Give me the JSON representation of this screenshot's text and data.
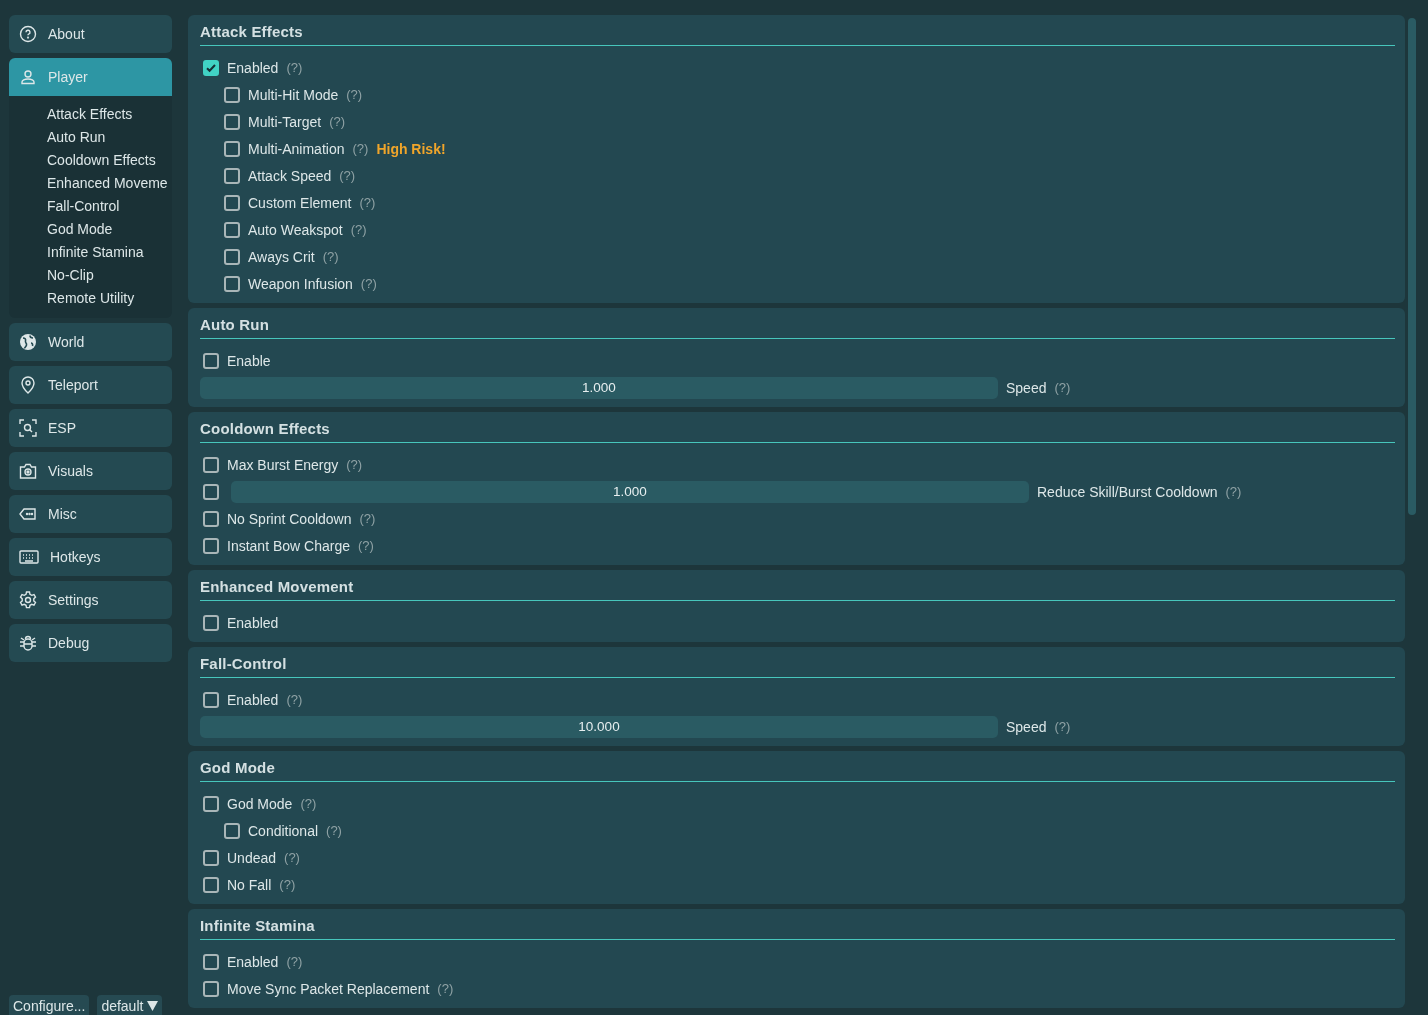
{
  "sidebar": {
    "items": [
      {
        "label": "About",
        "selected": false
      },
      {
        "label": "Player",
        "selected": true,
        "children": [
          "Attack Effects",
          "Auto Run",
          "Cooldown Effects",
          "Enhanced Moveme",
          "Fall-Control",
          "God Mode",
          "Infinite Stamina",
          "No-Clip",
          "Remote Utility"
        ]
      },
      {
        "label": "World",
        "selected": false
      },
      {
        "label": "Teleport",
        "selected": false
      },
      {
        "label": "ESP",
        "selected": false
      },
      {
        "label": "Visuals",
        "selected": false
      },
      {
        "label": "Misc",
        "selected": false
      },
      {
        "label": "Hotkeys",
        "selected": false
      },
      {
        "label": "Settings",
        "selected": false
      },
      {
        "label": "Debug",
        "selected": false
      }
    ],
    "configure_button": "Configure...",
    "profile_dropdown": "default"
  },
  "sections": [
    {
      "title": "Attack Effects",
      "rows": [
        {
          "kind": "checkbox",
          "label": "Enabled",
          "help": "(?)",
          "checked": true,
          "children": [
            {
              "kind": "checkbox",
              "label": "Multi-Hit Mode",
              "help": "(?)",
              "checked": false
            },
            {
              "kind": "checkbox",
              "label": "Multi-Target",
              "help": "(?)",
              "checked": false
            },
            {
              "kind": "checkbox",
              "label": "Multi-Animation",
              "help": "(?)",
              "warning": "High Risk!",
              "checked": false
            },
            {
              "kind": "checkbox",
              "label": "Attack Speed",
              "help": "(?)",
              "checked": false
            },
            {
              "kind": "checkbox",
              "label": "Custom Element",
              "help": "(?)",
              "checked": false
            },
            {
              "kind": "checkbox",
              "label": "Auto Weakspot",
              "help": "(?)",
              "checked": false
            },
            {
              "kind": "checkbox",
              "label": "Aways Crit",
              "help": "(?)",
              "checked": false
            },
            {
              "kind": "checkbox",
              "label": "Weapon Infusion",
              "help": "(?)",
              "checked": false
            }
          ]
        }
      ]
    },
    {
      "title": "Auto Run",
      "rows": [
        {
          "kind": "checkbox",
          "label": "Enable",
          "checked": false
        },
        {
          "kind": "slider",
          "value": "1.000",
          "level": 0,
          "label": "Speed",
          "help": "(?)"
        }
      ]
    },
    {
      "title": "Cooldown Effects",
      "rows": [
        {
          "kind": "checkbox",
          "label": "Max Burst Energy",
          "help": "(?)",
          "checked": false
        },
        {
          "kind": "checkbox_slider",
          "checked": false,
          "value": "1.000",
          "level": 0,
          "label": "Reduce Skill/Burst Cooldown",
          "help": "(?)"
        },
        {
          "kind": "checkbox",
          "label": "No Sprint Cooldown",
          "help": "(?)",
          "checked": false
        },
        {
          "kind": "checkbox",
          "label": "Instant Bow Charge",
          "help": "(?)",
          "checked": false
        }
      ]
    },
    {
      "title": "Enhanced Movement",
      "rows": [
        {
          "kind": "checkbox",
          "label": "Enabled",
          "checked": false
        }
      ]
    },
    {
      "title": "Fall-Control",
      "rows": [
        {
          "kind": "checkbox",
          "label": "Enabled",
          "help": "(?)",
          "checked": false
        },
        {
          "kind": "slider",
          "value": "10.000",
          "level": 0,
          "label": "Speed",
          "help": "(?)"
        }
      ]
    },
    {
      "title": "God Mode",
      "rows": [
        {
          "kind": "checkbox",
          "label": "God Mode",
          "help": "(?)",
          "checked": false,
          "children": [
            {
              "kind": "checkbox",
              "label": "Conditional",
              "help": "(?)",
              "checked": false
            }
          ]
        },
        {
          "kind": "checkbox",
          "label": "Undead",
          "help": "(?)",
          "checked": false
        },
        {
          "kind": "checkbox",
          "label": "No Fall",
          "help": "(?)",
          "checked": false
        }
      ]
    },
    {
      "title": "Infinite Stamina",
      "rows": [
        {
          "kind": "checkbox",
          "label": "Enabled",
          "help": "(?)",
          "checked": false
        },
        {
          "kind": "checkbox",
          "label": "Move Sync Packet Replacement",
          "help": "(?)",
          "checked": false
        }
      ]
    }
  ]
}
